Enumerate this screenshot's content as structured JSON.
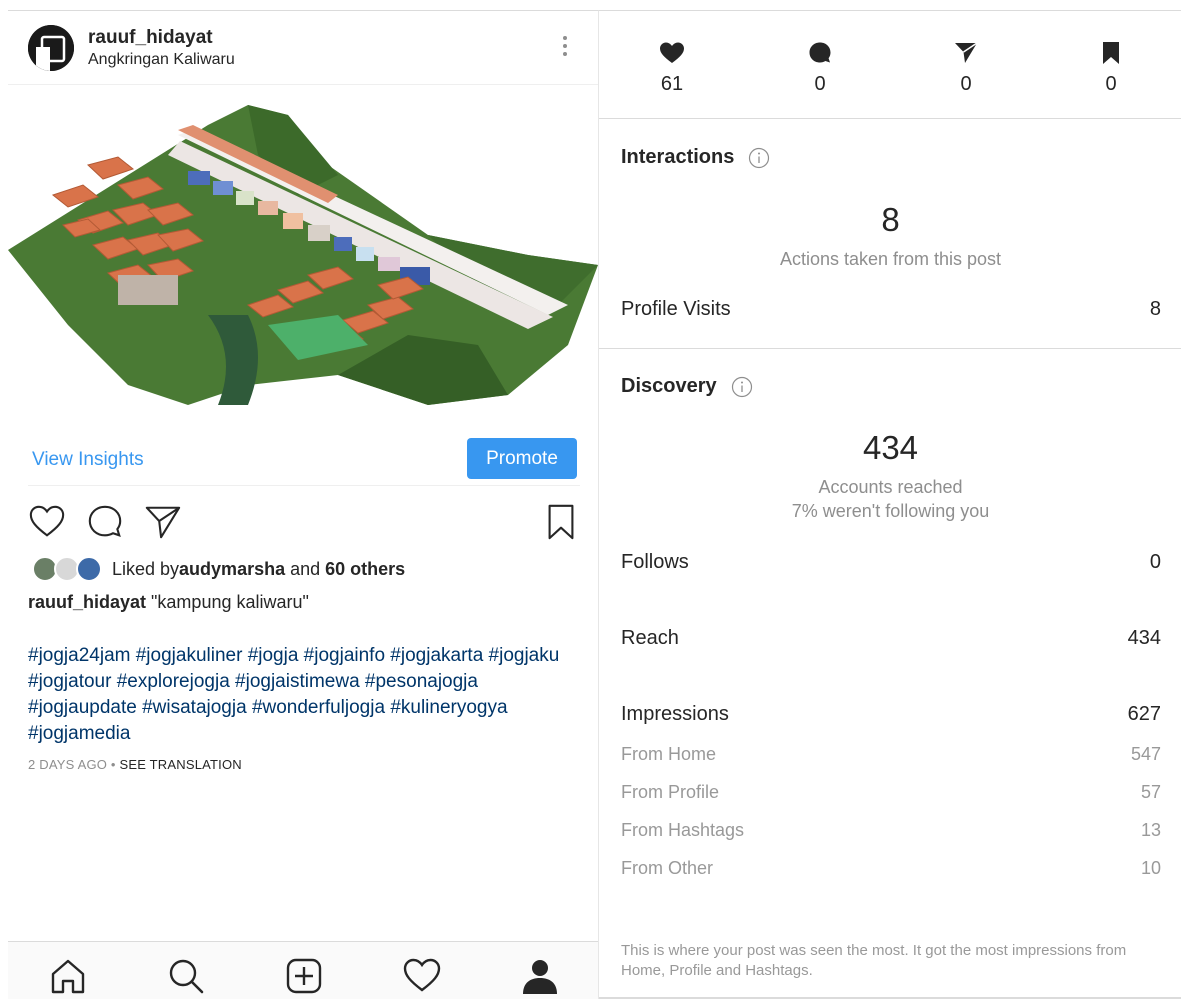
{
  "post": {
    "username": "rauuf_hidayat",
    "location": "Angkringan Kaliwaru",
    "view_insights": "View Insights",
    "promote": "Promote",
    "liked_prefix": "Liked by ",
    "liked_user": "audymarsha",
    "liked_and": " and ",
    "liked_others": "60 others",
    "caption_user": "rauuf_hidayat",
    "caption_text": " \"kampung kaliwaru\"",
    "hashtags": "#jogja24jam #jogjakuliner #jogja #jogjainfo #jogjakarta #jogjaku #jogjatour #explorejogja #jogjaistimewa #pesonajogja #jogjaupdate #wisatajogja #wonderfuljogja #kulineryogya #jogjamedia",
    "time": "2 DAYS AGO",
    "dot": " • ",
    "see_translation": "SEE TRANSLATION"
  },
  "stats": {
    "likes": "61",
    "comments": "0",
    "shares": "0",
    "saves": "0"
  },
  "interactions": {
    "title": "Interactions",
    "total": "8",
    "total_label": "Actions taken from this post",
    "profile_visits_label": "Profile Visits",
    "profile_visits": "8"
  },
  "discovery": {
    "title": "Discovery",
    "reached": "434",
    "reached_label": "Accounts reached",
    "not_following": "7% weren't following you",
    "follows_label": "Follows",
    "follows": "0",
    "reach_label": "Reach",
    "reach": "434",
    "impressions_label": "Impressions",
    "impressions": "627",
    "from_home_label": "From Home",
    "from_home": "547",
    "from_profile_label": "From Profile",
    "from_profile": "57",
    "from_hashtags_label": "From Hashtags",
    "from_hashtags": "13",
    "from_other_label": "From Other",
    "from_other": "10",
    "footnote": "This is where your post was seen the most. It got the most impressions from Home, Profile and Hashtags."
  },
  "colors": {
    "accent": "#3897f0",
    "hashtag": "#003569",
    "muted": "#8e8e8e"
  }
}
